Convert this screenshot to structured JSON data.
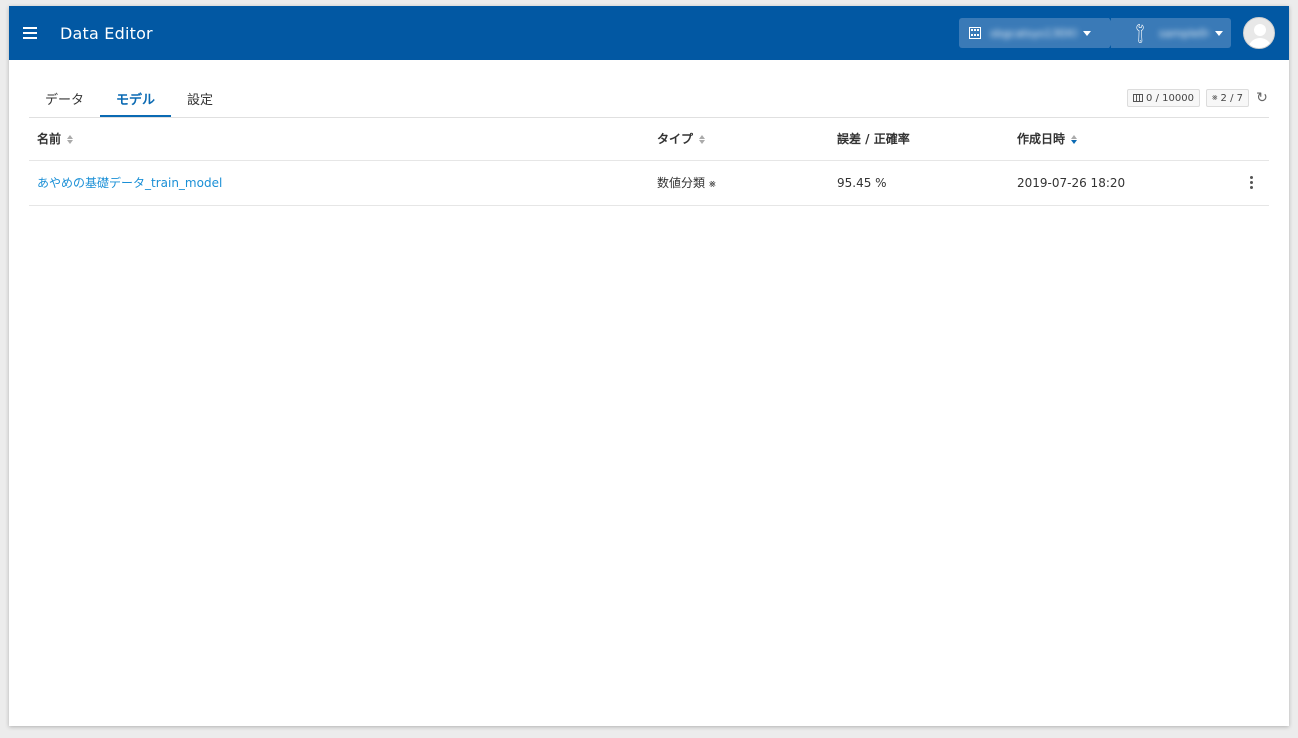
{
  "header": {
    "title": "Data Editor",
    "org_selector": "sbgcatsys130XXX",
    "project_selector": "sample04"
  },
  "tabs": [
    {
      "label": "データ",
      "active": false
    },
    {
      "label": "モデル",
      "active": true
    },
    {
      "label": "設定",
      "active": false
    }
  ],
  "tools": {
    "rows_badge": "0 / 10000",
    "models_badge": "2 / 7"
  },
  "table": {
    "columns": [
      "名前",
      "タイプ",
      "誤差 / 正確率",
      "作成日時"
    ],
    "rows": [
      {
        "name": "あやめの基礎データ_train_model",
        "type": "数値分類",
        "accuracy": "95.45 %",
        "created": "2019-07-26 18:20"
      }
    ]
  },
  "colors": {
    "appbar": "#0258a3",
    "accent": "#0a6ab3",
    "link": "#1a8fd6"
  },
  "icons": [
    "menu-icon",
    "building-icon",
    "wrench-icon",
    "avatar-icon",
    "table-icon",
    "network-icon",
    "refresh-icon",
    "kebab-icon"
  ]
}
